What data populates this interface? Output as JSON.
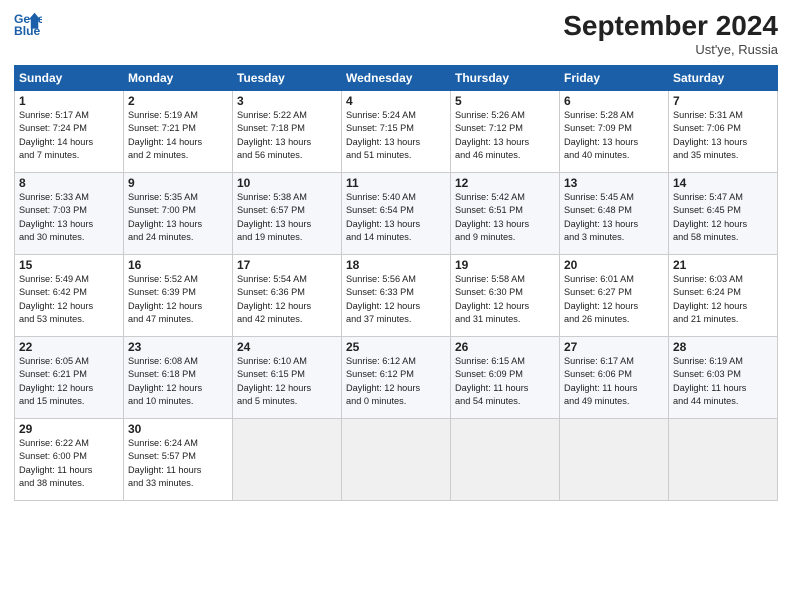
{
  "header": {
    "logo_line1": "General",
    "logo_line2": "Blue",
    "month": "September 2024",
    "location": "Ust'ye, Russia"
  },
  "days_of_week": [
    "Sunday",
    "Monday",
    "Tuesday",
    "Wednesday",
    "Thursday",
    "Friday",
    "Saturday"
  ],
  "weeks": [
    [
      {
        "day": "1",
        "info": "Sunrise: 5:17 AM\nSunset: 7:24 PM\nDaylight: 14 hours\nand 7 minutes."
      },
      {
        "day": "2",
        "info": "Sunrise: 5:19 AM\nSunset: 7:21 PM\nDaylight: 14 hours\nand 2 minutes."
      },
      {
        "day": "3",
        "info": "Sunrise: 5:22 AM\nSunset: 7:18 PM\nDaylight: 13 hours\nand 56 minutes."
      },
      {
        "day": "4",
        "info": "Sunrise: 5:24 AM\nSunset: 7:15 PM\nDaylight: 13 hours\nand 51 minutes."
      },
      {
        "day": "5",
        "info": "Sunrise: 5:26 AM\nSunset: 7:12 PM\nDaylight: 13 hours\nand 46 minutes."
      },
      {
        "day": "6",
        "info": "Sunrise: 5:28 AM\nSunset: 7:09 PM\nDaylight: 13 hours\nand 40 minutes."
      },
      {
        "day": "7",
        "info": "Sunrise: 5:31 AM\nSunset: 7:06 PM\nDaylight: 13 hours\nand 35 minutes."
      }
    ],
    [
      {
        "day": "8",
        "info": "Sunrise: 5:33 AM\nSunset: 7:03 PM\nDaylight: 13 hours\nand 30 minutes."
      },
      {
        "day": "9",
        "info": "Sunrise: 5:35 AM\nSunset: 7:00 PM\nDaylight: 13 hours\nand 24 minutes."
      },
      {
        "day": "10",
        "info": "Sunrise: 5:38 AM\nSunset: 6:57 PM\nDaylight: 13 hours\nand 19 minutes."
      },
      {
        "day": "11",
        "info": "Sunrise: 5:40 AM\nSunset: 6:54 PM\nDaylight: 13 hours\nand 14 minutes."
      },
      {
        "day": "12",
        "info": "Sunrise: 5:42 AM\nSunset: 6:51 PM\nDaylight: 13 hours\nand 9 minutes."
      },
      {
        "day": "13",
        "info": "Sunrise: 5:45 AM\nSunset: 6:48 PM\nDaylight: 13 hours\nand 3 minutes."
      },
      {
        "day": "14",
        "info": "Sunrise: 5:47 AM\nSunset: 6:45 PM\nDaylight: 12 hours\nand 58 minutes."
      }
    ],
    [
      {
        "day": "15",
        "info": "Sunrise: 5:49 AM\nSunset: 6:42 PM\nDaylight: 12 hours\nand 53 minutes."
      },
      {
        "day": "16",
        "info": "Sunrise: 5:52 AM\nSunset: 6:39 PM\nDaylight: 12 hours\nand 47 minutes."
      },
      {
        "day": "17",
        "info": "Sunrise: 5:54 AM\nSunset: 6:36 PM\nDaylight: 12 hours\nand 42 minutes."
      },
      {
        "day": "18",
        "info": "Sunrise: 5:56 AM\nSunset: 6:33 PM\nDaylight: 12 hours\nand 37 minutes."
      },
      {
        "day": "19",
        "info": "Sunrise: 5:58 AM\nSunset: 6:30 PM\nDaylight: 12 hours\nand 31 minutes."
      },
      {
        "day": "20",
        "info": "Sunrise: 6:01 AM\nSunset: 6:27 PM\nDaylight: 12 hours\nand 26 minutes."
      },
      {
        "day": "21",
        "info": "Sunrise: 6:03 AM\nSunset: 6:24 PM\nDaylight: 12 hours\nand 21 minutes."
      }
    ],
    [
      {
        "day": "22",
        "info": "Sunrise: 6:05 AM\nSunset: 6:21 PM\nDaylight: 12 hours\nand 15 minutes."
      },
      {
        "day": "23",
        "info": "Sunrise: 6:08 AM\nSunset: 6:18 PM\nDaylight: 12 hours\nand 10 minutes."
      },
      {
        "day": "24",
        "info": "Sunrise: 6:10 AM\nSunset: 6:15 PM\nDaylight: 12 hours\nand 5 minutes."
      },
      {
        "day": "25",
        "info": "Sunrise: 6:12 AM\nSunset: 6:12 PM\nDaylight: 12 hours\nand 0 minutes."
      },
      {
        "day": "26",
        "info": "Sunrise: 6:15 AM\nSunset: 6:09 PM\nDaylight: 11 hours\nand 54 minutes."
      },
      {
        "day": "27",
        "info": "Sunrise: 6:17 AM\nSunset: 6:06 PM\nDaylight: 11 hours\nand 49 minutes."
      },
      {
        "day": "28",
        "info": "Sunrise: 6:19 AM\nSunset: 6:03 PM\nDaylight: 11 hours\nand 44 minutes."
      }
    ],
    [
      {
        "day": "29",
        "info": "Sunrise: 6:22 AM\nSunset: 6:00 PM\nDaylight: 11 hours\nand 38 minutes."
      },
      {
        "day": "30",
        "info": "Sunrise: 6:24 AM\nSunset: 5:57 PM\nDaylight: 11 hours\nand 33 minutes."
      },
      {
        "day": "",
        "info": ""
      },
      {
        "day": "",
        "info": ""
      },
      {
        "day": "",
        "info": ""
      },
      {
        "day": "",
        "info": ""
      },
      {
        "day": "",
        "info": ""
      }
    ]
  ]
}
